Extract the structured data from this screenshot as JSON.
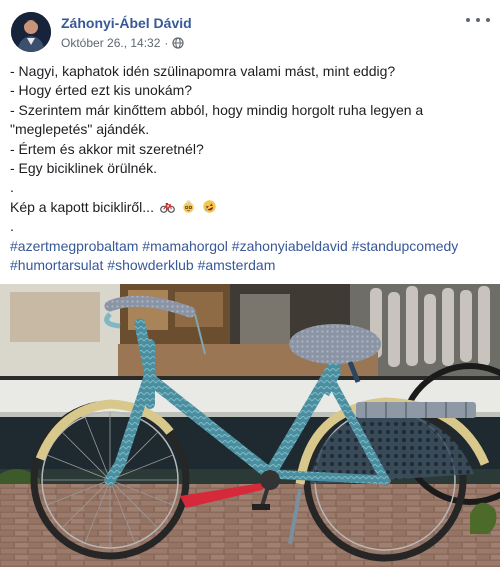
{
  "post": {
    "author_name": "Záhonyi-Ábel Dávid",
    "timestamp": "Október 26., 14:32",
    "separator": "·",
    "privacy_icon": "globe-icon",
    "more_icon": "more-dots-icon",
    "lines": [
      "- Nagyi, kaphatok idén szülinapomra valami mást, mint eddig?",
      "- Hogy érted ezt kis unokám?",
      "- Szerintem már kinőttem abból, hogy mindig horgolt ruha legyen a \"meglepetés\" ajándék.",
      "- Értem és akkor mit szeretnél?",
      "- Egy biciklinek örülnék.",
      ".",
      "Kép a kapott bicikliről...",
      "."
    ],
    "emojis": [
      "bicycle-emoji",
      "old-woman-emoji",
      "rofl-emoji"
    ],
    "hashtags": [
      "#azertmegprobaltam",
      "#mamahorgol",
      "#zahonyiabeldavid",
      "#standupcomedy",
      "#humortarsulat",
      "#showderklub",
      "#amsterdam"
    ]
  },
  "photo": {
    "subject": "crochet-covered bicycle"
  },
  "colors": {
    "link": "#385898",
    "text": "#1c1e21",
    "meta": "#606770",
    "bike_frame": "#4a8fa0",
    "fender": "#d8c88c",
    "chain_guard": "#d62a3a"
  }
}
